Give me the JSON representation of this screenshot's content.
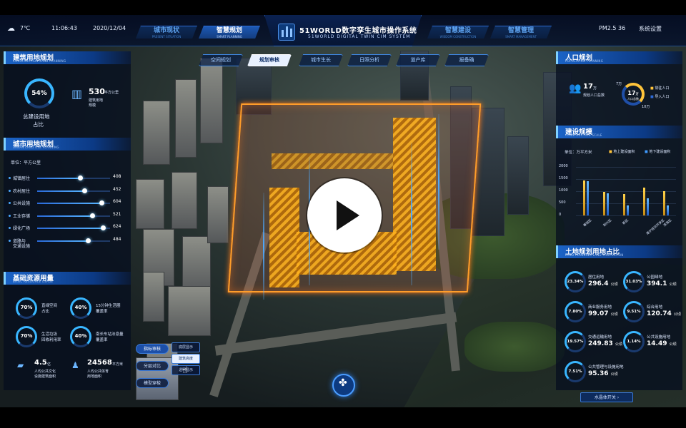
{
  "topbar": {
    "weather": "7℃",
    "time": "11:06:43",
    "date": "2020/12/04",
    "left_tabs": [
      {
        "label": "城市现状",
        "sub": "PRESENT SITUATION"
      },
      {
        "label": "智慧规划",
        "sub": "SMART PLANNING"
      }
    ],
    "right_tabs": [
      {
        "label": "智慧建设",
        "sub": "WISDOM CONSTRUCTION"
      },
      {
        "label": "智慧管理",
        "sub": "SMART MANAGEMENT"
      }
    ],
    "title": "51WORLD数字孪生城市操作系统",
    "title_sub": "51WORLD DIGITAL TWIN CIM SYSTEM",
    "pm": "PM2.5 36",
    "settings": "系统设置"
  },
  "subnav": [
    "空间规划",
    "规划审核",
    "城市生长",
    "日照分析",
    "道产库",
    "报备确"
  ],
  "land": {
    "title": "建筑用地规划",
    "sub": "CONSTRUCTION LAND PLANNING",
    "percent": "54%",
    "caption1": "总建设用地",
    "caption2": "占比",
    "area_value": "530",
    "area_unit": "平方公里",
    "area_caption1": "建筑用地",
    "area_caption2": "规模"
  },
  "urban": {
    "title": "城市用地规划",
    "sub": "URBAN LAND USE PLANNING",
    "unit": "单位：平方公里",
    "rows": [
      {
        "label": "城镇居住",
        "value": "408",
        "pct": 0.59
      },
      {
        "label": "农村居住",
        "value": "452",
        "pct": 0.65
      },
      {
        "label": "公共设施",
        "value": "604",
        "pct": 0.88
      },
      {
        "label": "工业存储",
        "value": "521",
        "pct": 0.75
      },
      {
        "label": "绿化广场",
        "value": "624",
        "pct": 0.9
      },
      {
        "label": "道路与",
        "label2": "交通设施",
        "value": "484",
        "pct": 0.7
      }
    ]
  },
  "basic": {
    "title": "基础资源用量",
    "sub": "BASIC RESOURCE USAGE",
    "items": [
      {
        "pct": "70%",
        "l1": "直绿空间",
        "l2": "占比"
      },
      {
        "pct": "40%",
        "l1": "15分钟生活圈",
        "l2": "覆盖率"
      },
      {
        "pct": "70%",
        "l1": "生活垃圾",
        "l2": "回收利用率"
      },
      {
        "pct": "40%",
        "l1": "南长车站法息量",
        "l2": "覆盖率"
      }
    ],
    "stat1_value": "4.5",
    "stat1_unit": "亿",
    "stat1_l1": "人均公共文化",
    "stat1_l2": "设施建筑面积",
    "stat2_value": "24568",
    "stat2_unit": "平方米",
    "stat2_l1": "人均公共体育",
    "stat2_l2": "用地面积"
  },
  "population": {
    "title": "人口规划",
    "sub": "POPULATION PLANNING",
    "total_value": "17",
    "total_unit": "万",
    "total_caption": "规划人口总数",
    "ring_value": "17",
    "ring_unit": "万",
    "ring_caption": "人口总数",
    "axis_top": "7万",
    "axis_bottom": "10万",
    "legend": [
      "常驻人口",
      "导入人口"
    ]
  },
  "scale": {
    "title": "建设规模",
    "sub": "CONSTRUCTION SCALE",
    "unit": "单位：万平方米",
    "legend": [
      "地上建设面积",
      "地下建设面积"
    ],
    "y_ticks": [
      "2000",
      "1500",
      "1000",
      "500",
      "0"
    ],
    "categories": [
      "春城区",
      "积兴区",
      "新区",
      "南宁经济开发区",
      "滨海区"
    ]
  },
  "chart_data": {
    "type": "bar",
    "categories": [
      "春城区",
      "积兴区",
      "新区",
      "南宁经济开发区",
      "滨海区"
    ],
    "series": [
      {
        "name": "地上建设面积",
        "values": [
          1450,
          980,
          880,
          1150,
          1000
        ]
      },
      {
        "name": "地下建设面积",
        "values": [
          1400,
          900,
          420,
          700,
          400
        ]
      }
    ],
    "ylim": [
      0,
      2000
    ]
  },
  "landprop": {
    "title": "土地规划用地占比",
    "sub": "LAND PLANNING LAND PROPORTION",
    "unit": "公顷",
    "items": [
      {
        "pct": "23.34%",
        "label": "居住用地",
        "value": "296.4"
      },
      {
        "pct": "31.03%",
        "label": "公园绿地",
        "value": "394.1"
      },
      {
        "pct": "7.80%",
        "label": "商业服务用地",
        "value": "99.07"
      },
      {
        "pct": "9.51%",
        "label": "综合用地",
        "value": "120.74"
      },
      {
        "pct": "19.57%",
        "label": "交通运输用地",
        "value": "249.83"
      },
      {
        "pct": "1.14%",
        "label": "公共设施用地",
        "value": "14.49"
      },
      {
        "pct": "7.51%",
        "label": "公共管理与设施用地",
        "value": "95.36"
      }
    ]
  },
  "tools": {
    "items": [
      "指标审核",
      "分层对比",
      "模型穿梭"
    ],
    "popup": [
      "底层显示",
      "建筑高度",
      "透明显示"
    ]
  },
  "bottom": {
    "toggle": "水晶体开关"
  }
}
